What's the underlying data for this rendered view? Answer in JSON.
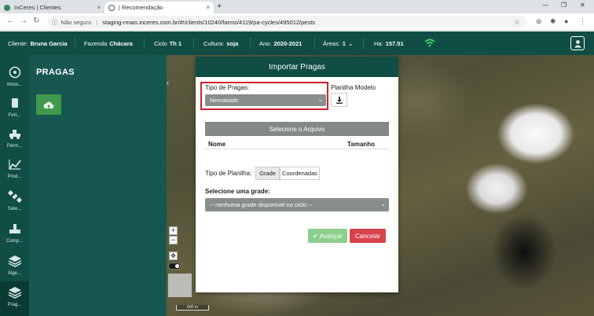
{
  "browser": {
    "tabs": [
      {
        "label": "InCeres | Clientes",
        "close": "×"
      },
      {
        "label": "| Recomendação",
        "close": "×"
      }
    ],
    "new_tab": "+",
    "address": {
      "insecure_label": "Não seguro",
      "separator": "|",
      "url": "staging-rmais.inceres.com.br/#!/clients/10240/farms/4119/pa-cycles/495012/pests"
    },
    "window_controls": {
      "minimize": "—",
      "restore": "❐",
      "close": "✕"
    }
  },
  "header": {
    "client_label": "Cliente:",
    "client_value": "Bruna Garcia",
    "farm_label": "Fazenda",
    "farm_value": "Chácara",
    "cycle_label": "Ciclo",
    "cycle_value": "Th 1",
    "crop_label": "Cultura:",
    "crop_value": "soja",
    "year_label": "Ano:",
    "year_value": "2020-2021",
    "areas_label": "Áreas:",
    "areas_value": "1",
    "ha_label": "Ha:",
    "ha_value": "157.51",
    "colors": {
      "bg": "#0f4d45",
      "wifi": "#45e06a"
    }
  },
  "sidebar": {
    "items": [
      {
        "label": "Amos...",
        "icon": "sample-icon"
      },
      {
        "label": "Fert...",
        "icon": "fertilizer-icon"
      },
      {
        "label": "Perm...",
        "icon": "equipment-icon"
      },
      {
        "label": "Prod...",
        "icon": "chart-icon"
      },
      {
        "label": "Sate...",
        "icon": "satellite-icon"
      },
      {
        "label": "Comp...",
        "icon": "compaction-icon"
      },
      {
        "label": "Álge...",
        "icon": "layers-icon"
      },
      {
        "label": "Prag...",
        "icon": "layers-icon"
      }
    ]
  },
  "panel": {
    "title": "PRAGAS"
  },
  "map": {
    "zoom_in": "+",
    "zoom_out": "−",
    "scale_label": "600 m"
  },
  "modal": {
    "title": "Importar Pragas",
    "pest_type_label": "Tipo de Pragas:",
    "pest_type_value": "Nematoide",
    "template_label": "Planilha Modelo",
    "select_file_label": "Selecione o Arquivo",
    "col_name": "Nome",
    "col_size": "Tamanho",
    "sheet_type_label": "Tipo de Planilha:",
    "sheet_type_options": [
      "Grade",
      "Coordenadas"
    ],
    "sheet_type_selected": "Grade",
    "grid_label": "Selecione uma grade:",
    "grid_value": "-- nenhuma grade disponível no ciclo --",
    "advance_label": "Avançar",
    "cancel_label": "Cancelar"
  }
}
